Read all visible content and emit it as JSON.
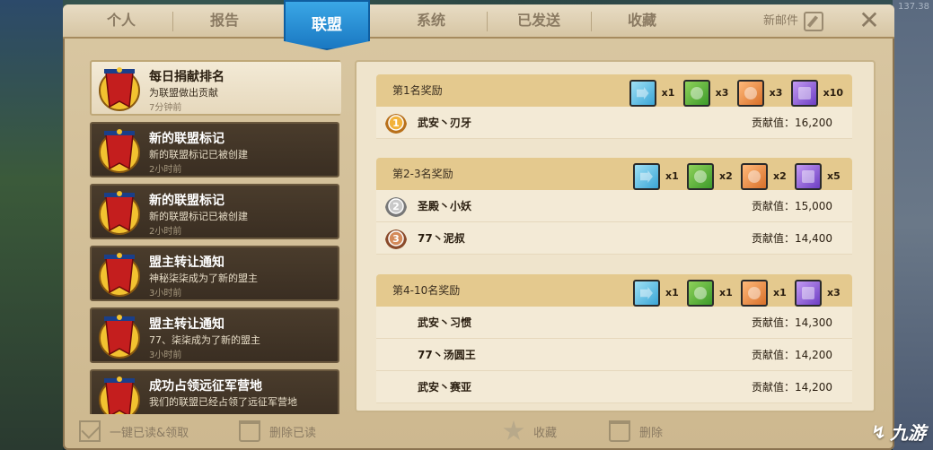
{
  "window": {
    "coords_text": "137.38"
  },
  "tabs": [
    {
      "label": "个人"
    },
    {
      "label": "报告"
    },
    {
      "label": "联盟",
      "active": true
    },
    {
      "label": "系统"
    },
    {
      "label": "已发送"
    },
    {
      "label": "收藏"
    }
  ],
  "header": {
    "new_mail_label": "新邮件",
    "close_icon": "close-icon"
  },
  "mail_list": [
    {
      "title": "每日捐献排名",
      "subtitle": "为联盟做出贡献",
      "time": "7分钟前",
      "active": true
    },
    {
      "title": "新的联盟标记",
      "subtitle": "新的联盟标记已被创建",
      "time": "2小时前"
    },
    {
      "title": "新的联盟标记",
      "subtitle": "新的联盟标记已被创建",
      "time": "2小时前"
    },
    {
      "title": "盟主转让通知",
      "subtitle": "神秘柒柒成为了新的盟主",
      "time": "3小时前"
    },
    {
      "title": "盟主转让通知",
      "subtitle": "77、柒柒成为了新的盟主",
      "time": "3小时前"
    },
    {
      "title": "成功占领远征军营地",
      "subtitle": "我们的联盟已经占领了远征军营地",
      "time": ""
    }
  ],
  "content": {
    "sections": [
      {
        "title": "第1名奖励",
        "rewards": [
          {
            "icon": "speedup-icon",
            "count": "x1"
          },
          {
            "icon": "food-icon",
            "count": "x3"
          },
          {
            "icon": "wood-icon",
            "count": "x3"
          },
          {
            "icon": "tome-icon",
            "count": "x10"
          }
        ],
        "rows": [
          {
            "rank_icon": "gold-medal-icon",
            "name": "武安丶刃牙",
            "score": "贡献值：16,200"
          }
        ]
      },
      {
        "title": "第2-3名奖励",
        "rewards": [
          {
            "icon": "speedup-icon",
            "count": "x1"
          },
          {
            "icon": "food-icon",
            "count": "x2"
          },
          {
            "icon": "wood-icon",
            "count": "x2"
          },
          {
            "icon": "tome-icon",
            "count": "x5"
          }
        ],
        "rows": [
          {
            "rank_icon": "silver-medal-icon",
            "name": "圣殿丶小妖",
            "score": "贡献值：15,000"
          },
          {
            "rank_icon": "bronze-medal-icon",
            "name": "77丶泥叔",
            "score": "贡献值：14,400"
          }
        ]
      },
      {
        "title": "第4-10名奖励",
        "rewards": [
          {
            "icon": "speedup-icon",
            "count": "x1"
          },
          {
            "icon": "food-icon",
            "count": "x1"
          },
          {
            "icon": "wood-icon",
            "count": "x1"
          },
          {
            "icon": "tome-icon",
            "count": "x3"
          }
        ],
        "rows": [
          {
            "name": "武安丶习惯",
            "score": "贡献值：14,300"
          },
          {
            "name": "77丶汤圆王",
            "score": "贡献值：14,200"
          },
          {
            "name": "武安丶赛亚",
            "score": "贡献值：14,200"
          }
        ]
      }
    ]
  },
  "bottom_bar": {
    "read_all_label": "一键已读&领取",
    "delete_read_label": "删除已读",
    "favorite_label": "收藏",
    "delete_label": "删除"
  },
  "watermark": {
    "text": "九游"
  },
  "colors": {
    "accent": "#1a78c2",
    "panel": "#d9c7a2",
    "section_header": "#e4c98e"
  }
}
